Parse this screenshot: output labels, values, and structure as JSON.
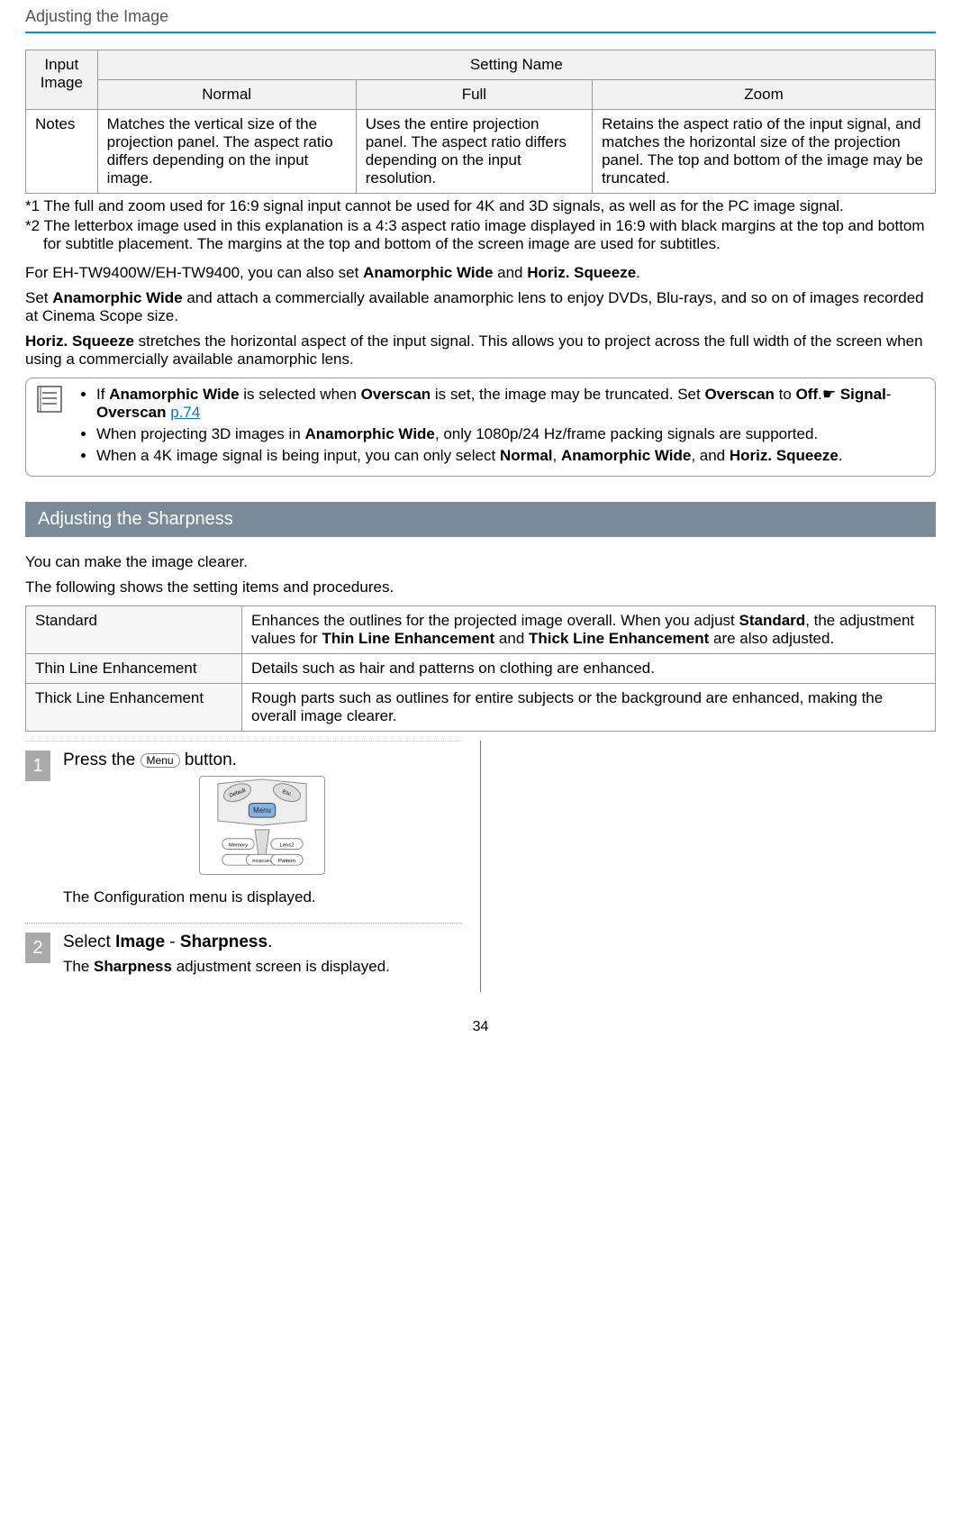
{
  "header": {
    "title": "Adjusting the Image"
  },
  "aspect_table": {
    "input_image_header": "Input Image",
    "setting_name_header": "Setting Name",
    "cols": {
      "normal": "Normal",
      "full": "Full",
      "zoom": "Zoom"
    },
    "row_label": "Notes",
    "cells": {
      "normal": "Matches the vertical size of the projection panel. The aspect ratio differs depending on the input image.",
      "full": "Uses the entire projection panel. The aspect ratio differs depending on the input resolution.",
      "zoom": "Retains the aspect ratio of the input signal, and matches the horizontal size of the projection panel. The top and bottom of the image may be truncated."
    }
  },
  "footnotes": {
    "f1": "*1 The full and zoom used for 16:9 signal input cannot be used for 4K and 3D signals, as well as for the PC image signal.",
    "f2": "*2 The letterbox image used in this explanation is a 4:3 aspect ratio image displayed in 16:9 with black margins at the top and bottom for subtitle placement. The margins at the top and bottom of the screen image are used for subtitles."
  },
  "body": {
    "p1_pre": "For EH-TW9400W/EH-TW9400, you can also set ",
    "p1_b1": "Anamorphic Wide",
    "p1_mid": " and ",
    "p1_b2": "Horiz. Squeeze",
    "p1_post": ".",
    "p2_pre": "Set ",
    "p2_b1": "Anamorphic Wide",
    "p2_post": " and attach a commercially available anamorphic lens to enjoy DVDs, Blu-rays, and so on of images recorded at Cinema Scope size.",
    "p3_b1": "Horiz. Squeeze",
    "p3_post": " stretches the horizontal aspect of the input signal. This allows you to project across the full width of the screen when using a commercially available anamorphic lens."
  },
  "notebox": {
    "li1": {
      "t1": "If ",
      "b1": "Anamorphic Wide",
      "t2": " is selected when ",
      "b2": "Overscan",
      "t3": " is set, the image may be truncated. Set ",
      "b3": "Overscan",
      "t4": " to ",
      "b4": "Off",
      "t5": ".",
      "hand": "☛",
      "b5": "Signal",
      "dash": "-",
      "b6": "Overscan",
      "link": "p.74"
    },
    "li2": {
      "t1": "When projecting 3D images in ",
      "b1": "Anamorphic Wide",
      "t2": ", only 1080p/24 Hz/frame packing signals are supported."
    },
    "li3": {
      "t1": "When a 4K image signal is being input, you can only select ",
      "b1": "Normal",
      "t2": ", ",
      "b2": "Anamorphic Wide",
      "t3": ", and ",
      "b3": "Horiz. Squeeze",
      "t4": "."
    }
  },
  "section": {
    "title": "Adjusting the Sharpness"
  },
  "sharp_intro": {
    "p1": "You can make the image clearer.",
    "p2": "The following shows the setting items and procedures."
  },
  "sharp_table": {
    "r1": {
      "label": "Standard",
      "pre": "Enhances the outlines for the projected image overall. When you adjust ",
      "b1": "Standard",
      "mid": ", the adjustment values for ",
      "b2": "Thin Line Enhancement",
      "mid2": " and ",
      "b3": "Thick Line Enhancement",
      "post": " are also adjusted."
    },
    "r2": {
      "label": "Thin Line Enhancement",
      "desc": "Details such as hair and patterns on clothing are enhanced."
    },
    "r3": {
      "label": "Thick Line Enhancement",
      "desc": "Rough parts such as outlines for entire subjects or the background are enhanced, making the overall image clearer."
    }
  },
  "steps": {
    "s1": {
      "num": "1",
      "title_pre": "Press the ",
      "menu_label": "Menu",
      "title_post": " button.",
      "result": "The Configuration menu is displayed."
    },
    "s2": {
      "num": "2",
      "title_pre": "Select ",
      "b1": "Image",
      "dash": " - ",
      "b2": "Sharpness",
      "title_post": ".",
      "result_pre": "The ",
      "result_b": "Sharpness",
      "result_post": " adjustment screen is displayed."
    }
  },
  "page_number": "34",
  "chart_data": {
    "type": "table"
  }
}
